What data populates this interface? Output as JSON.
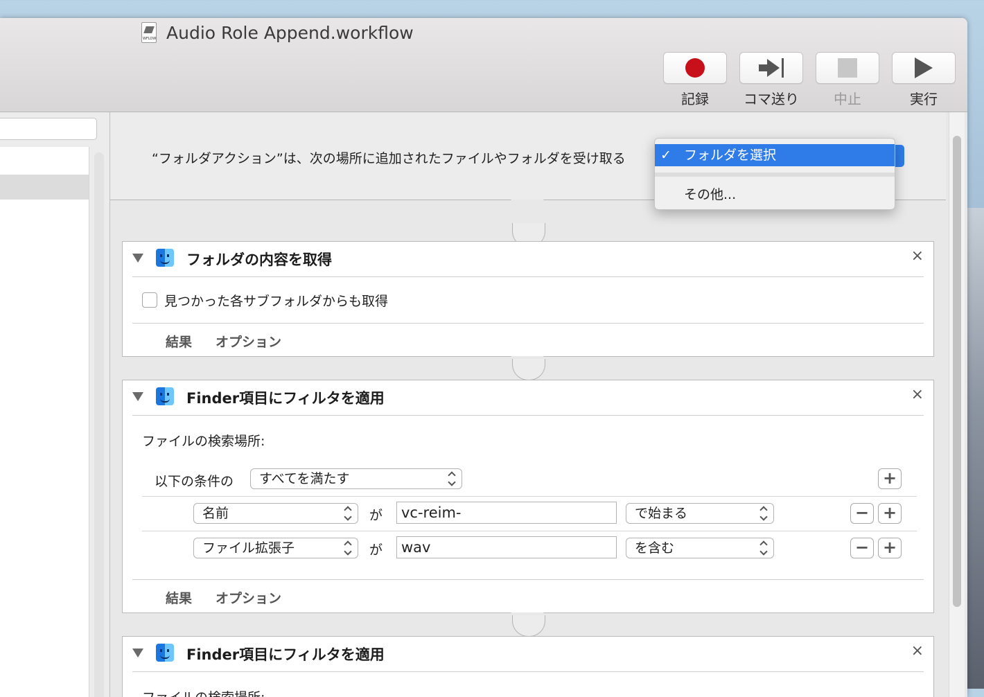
{
  "window": {
    "title": "Audio Role Append.workflow",
    "doc_icon_text": "WFLOW"
  },
  "toolbar": {
    "record_label": "記録",
    "step_label": "コマ送り",
    "stop_label": "中止",
    "run_label": "実行",
    "record_color": "#c8101a"
  },
  "header": {
    "receives_text": "“フォルダアクション”は、次の場所に追加されたファイルやフォルダを受け取る"
  },
  "menu": {
    "check": "✓",
    "selected_item": "フォルダを選択",
    "other_item": "その他...",
    "accent": "#2f7ce9"
  },
  "actions": [
    {
      "title": "フォルダの内容を取得",
      "checkbox_label": "見つかった各サブフォルダからも取得",
      "checkbox_checked": false,
      "footer_results": "結果",
      "footer_options": "オプション"
    },
    {
      "title": "Finder項目にフィルタを適用",
      "search_location_label": "ファイルの検索場所:",
      "condition_prefix": "以下の条件の",
      "condition_match": "すべてを満たす",
      "rules": [
        {
          "field": "名前",
          "connector": "が",
          "value": "vc-reim-",
          "operator": "で始まる"
        },
        {
          "field": "ファイル拡張子",
          "connector": "が",
          "value": "wav",
          "operator": "を含む"
        }
      ],
      "footer_results": "結果",
      "footer_options": "オプション"
    },
    {
      "title": "Finder項目にフィルタを適用",
      "search_location_label": "ファイルの検索場所:"
    }
  ],
  "icons": {
    "close": "×",
    "plus": "+",
    "minus": "−"
  }
}
